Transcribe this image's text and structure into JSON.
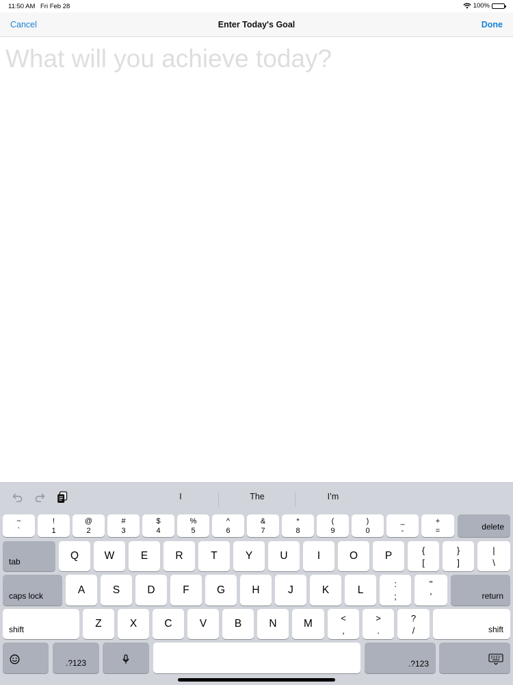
{
  "status": {
    "time": "11:50 AM",
    "date": "Fri Feb 28",
    "battery": "100%"
  },
  "nav": {
    "cancel": "Cancel",
    "title": "Enter Today's Goal",
    "done": "Done"
  },
  "goal": {
    "placeholder": "What will you achieve today?",
    "value": ""
  },
  "keyboard": {
    "suggestions": [
      "I",
      "The",
      "I’m"
    ],
    "number_row": [
      {
        "top": "~",
        "bottom": "`"
      },
      {
        "top": "!",
        "bottom": "1"
      },
      {
        "top": "@",
        "bottom": "2"
      },
      {
        "top": "#",
        "bottom": "3"
      },
      {
        "top": "$",
        "bottom": "4"
      },
      {
        "top": "%",
        "bottom": "5"
      },
      {
        "top": "^",
        "bottom": "6"
      },
      {
        "top": "&",
        "bottom": "7"
      },
      {
        "top": "*",
        "bottom": "8"
      },
      {
        "top": "(",
        "bottom": "9"
      },
      {
        "top": ")",
        "bottom": "0"
      },
      {
        "top": "_",
        "bottom": "-"
      },
      {
        "top": "+",
        "bottom": "="
      }
    ],
    "delete": "delete",
    "tab": "tab",
    "row_q": [
      "Q",
      "W",
      "E",
      "R",
      "T",
      "Y",
      "U",
      "I",
      "O",
      "P"
    ],
    "row_q_punct": [
      {
        "top": "{",
        "bottom": "["
      },
      {
        "top": "}",
        "bottom": "]"
      },
      {
        "top": "|",
        "bottom": "\\"
      }
    ],
    "caps_lock": "caps lock",
    "row_a": [
      "A",
      "S",
      "D",
      "F",
      "G",
      "H",
      "J",
      "K",
      "L"
    ],
    "row_a_punct": [
      {
        "top": ":",
        "bottom": ";"
      },
      {
        "top": "\"",
        "bottom": "'"
      }
    ],
    "return": "return",
    "shift_left": "shift",
    "row_z": [
      "Z",
      "X",
      "C",
      "V",
      "B",
      "N",
      "M"
    ],
    "row_z_punct": [
      {
        "top": "<",
        "bottom": ","
      },
      {
        "top": ">",
        "bottom": "."
      },
      {
        "top": "?",
        "bottom": "/"
      }
    ],
    "shift_right": "shift",
    "numbers_left": ".?123",
    "numbers_right": ".?123",
    "space": ""
  }
}
